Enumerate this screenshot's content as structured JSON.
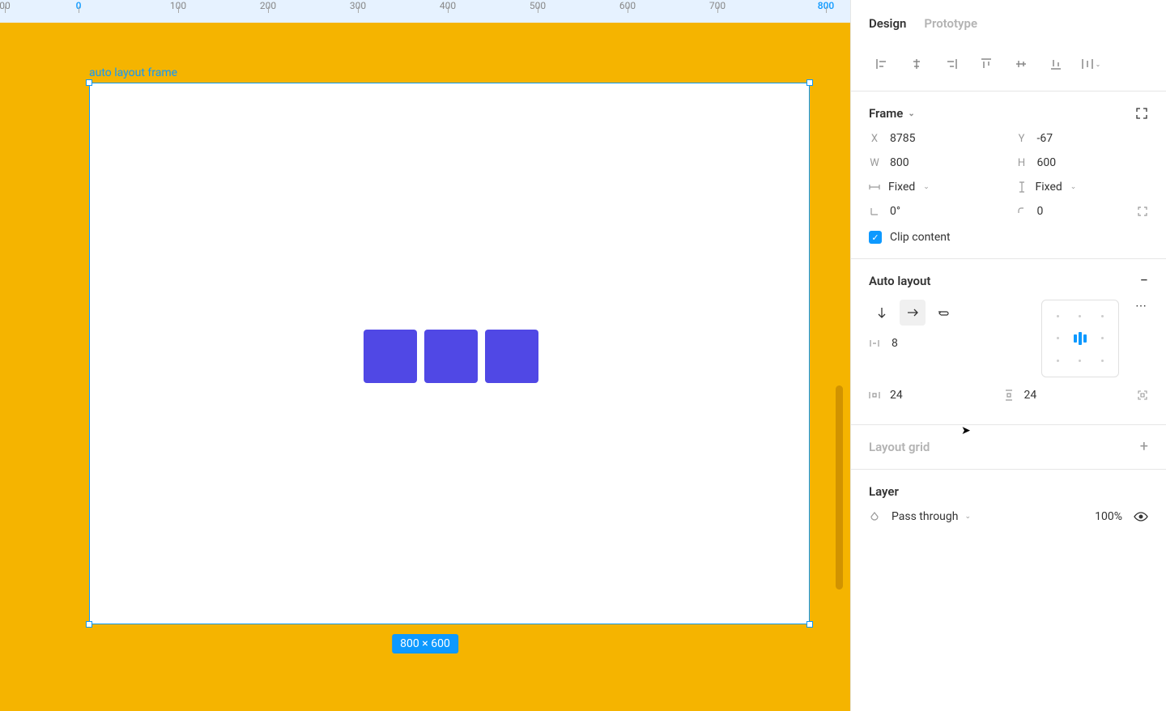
{
  "ruler": {
    "ticks": [
      {
        "label": "00",
        "pos": 6,
        "active": false
      },
      {
        "label": "0",
        "pos": 97,
        "active": true
      },
      {
        "label": "100",
        "pos": 220,
        "active": false
      },
      {
        "label": "200",
        "pos": 331,
        "active": false
      },
      {
        "label": "300",
        "pos": 442,
        "active": false
      },
      {
        "label": "400",
        "pos": 553,
        "active": false
      },
      {
        "label": "500",
        "pos": 664,
        "active": false
      },
      {
        "label": "600",
        "pos": 775,
        "active": false
      },
      {
        "label": "700",
        "pos": 886,
        "active": false
      },
      {
        "label": "800",
        "pos": 1020,
        "active": true
      }
    ]
  },
  "canvas": {
    "frame_label": "auto layout frame",
    "size_badge": "800 × 600"
  },
  "tabs": {
    "design": "Design",
    "prototype": "Prototype"
  },
  "frame": {
    "title": "Frame",
    "x_label": "X",
    "x": "8785",
    "y_label": "Y",
    "y": "-67",
    "w_label": "W",
    "w": "800",
    "h_label": "H",
    "h": "600",
    "w_mode": "Fixed",
    "h_mode": "Fixed",
    "rotation": "0°",
    "corner": "0",
    "clip_label": "Clip content"
  },
  "autolayout": {
    "title": "Auto layout",
    "gap": "8",
    "pad_h": "24",
    "pad_v": "24"
  },
  "layout_grid": {
    "title": "Layout grid"
  },
  "layer": {
    "title": "Layer",
    "mode": "Pass through",
    "opacity": "100%"
  }
}
